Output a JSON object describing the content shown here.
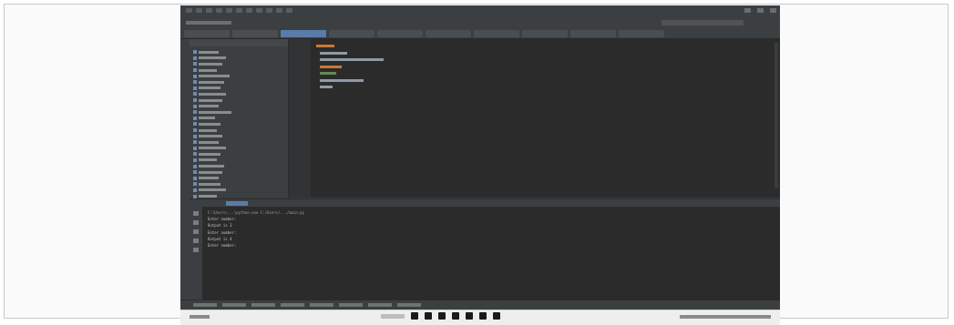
{
  "editor": {
    "code_lines": 7
  },
  "project_tree": {
    "item_count": 26
  },
  "console": {
    "lines": [
      "C:\\Users\\...\\python.exe C:/Users/.../main.py",
      "Enter number:",
      "Output is 3",
      "Enter number:",
      "Output is 4",
      "Enter number:"
    ]
  },
  "colors": {
    "ide_background": "#2b2b2b",
    "panel_background": "#3c3f41",
    "accent": "#5b7ba8",
    "keyword": "#cc7832",
    "string": "#6a8759"
  },
  "icons": {
    "taskbar": [
      "search-icon",
      "task-view-icon",
      "explorer-icon",
      "edge-icon",
      "store-icon",
      "mail-icon",
      "settings-icon",
      "pycharm-icon"
    ]
  }
}
